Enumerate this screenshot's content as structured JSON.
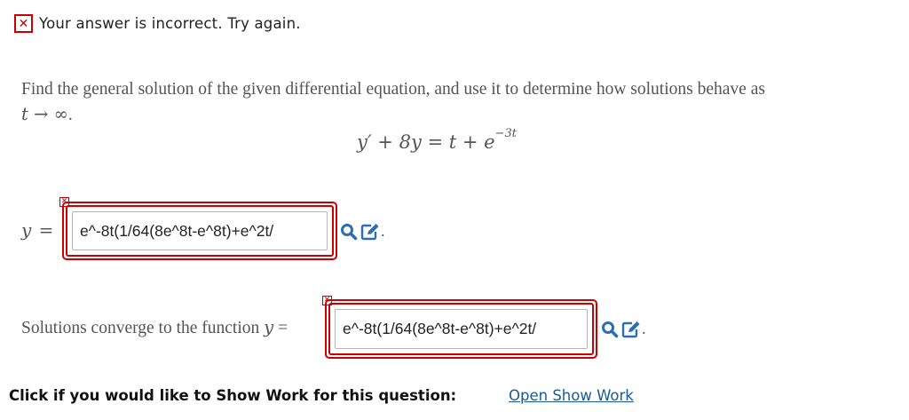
{
  "feedback": {
    "icon": "x-mark-icon",
    "text": "Your answer is incorrect.  Try again.",
    "color": "#cc0000"
  },
  "question": {
    "text_main": "Find the general solution of the given differential equation, and use it to determine how solutions behave as",
    "limit_expr": "t → ∞",
    "limit_end": "."
  },
  "equation": {
    "lhs": "y′ + 8y = t + e",
    "exponent": "−3t"
  },
  "answer1": {
    "label_var": "y",
    "label_eq": "=",
    "value": "e^-8t(1/64(8e^8t-e^8t)+e^2t/",
    "status": "incorrect"
  },
  "answer2": {
    "label": "Solutions converge to the function ",
    "label_var": "y",
    "label_eq": "=",
    "value": "e^-8t(1/64(8e^8t-e^8t)+e^2t/",
    "status": "incorrect"
  },
  "tools": {
    "preview_icon": "magnifier-icon",
    "edit_icon": "pencil-edit-icon",
    "period": "."
  },
  "show_work": {
    "prompt": "Click if you would like to Show Work for this question:",
    "link": "Open Show Work",
    "link_color": "#1a5a96"
  },
  "colors": {
    "error": "#cc0000",
    "icon_blue": "#2a6fb5",
    "text_gray": "#545454"
  }
}
